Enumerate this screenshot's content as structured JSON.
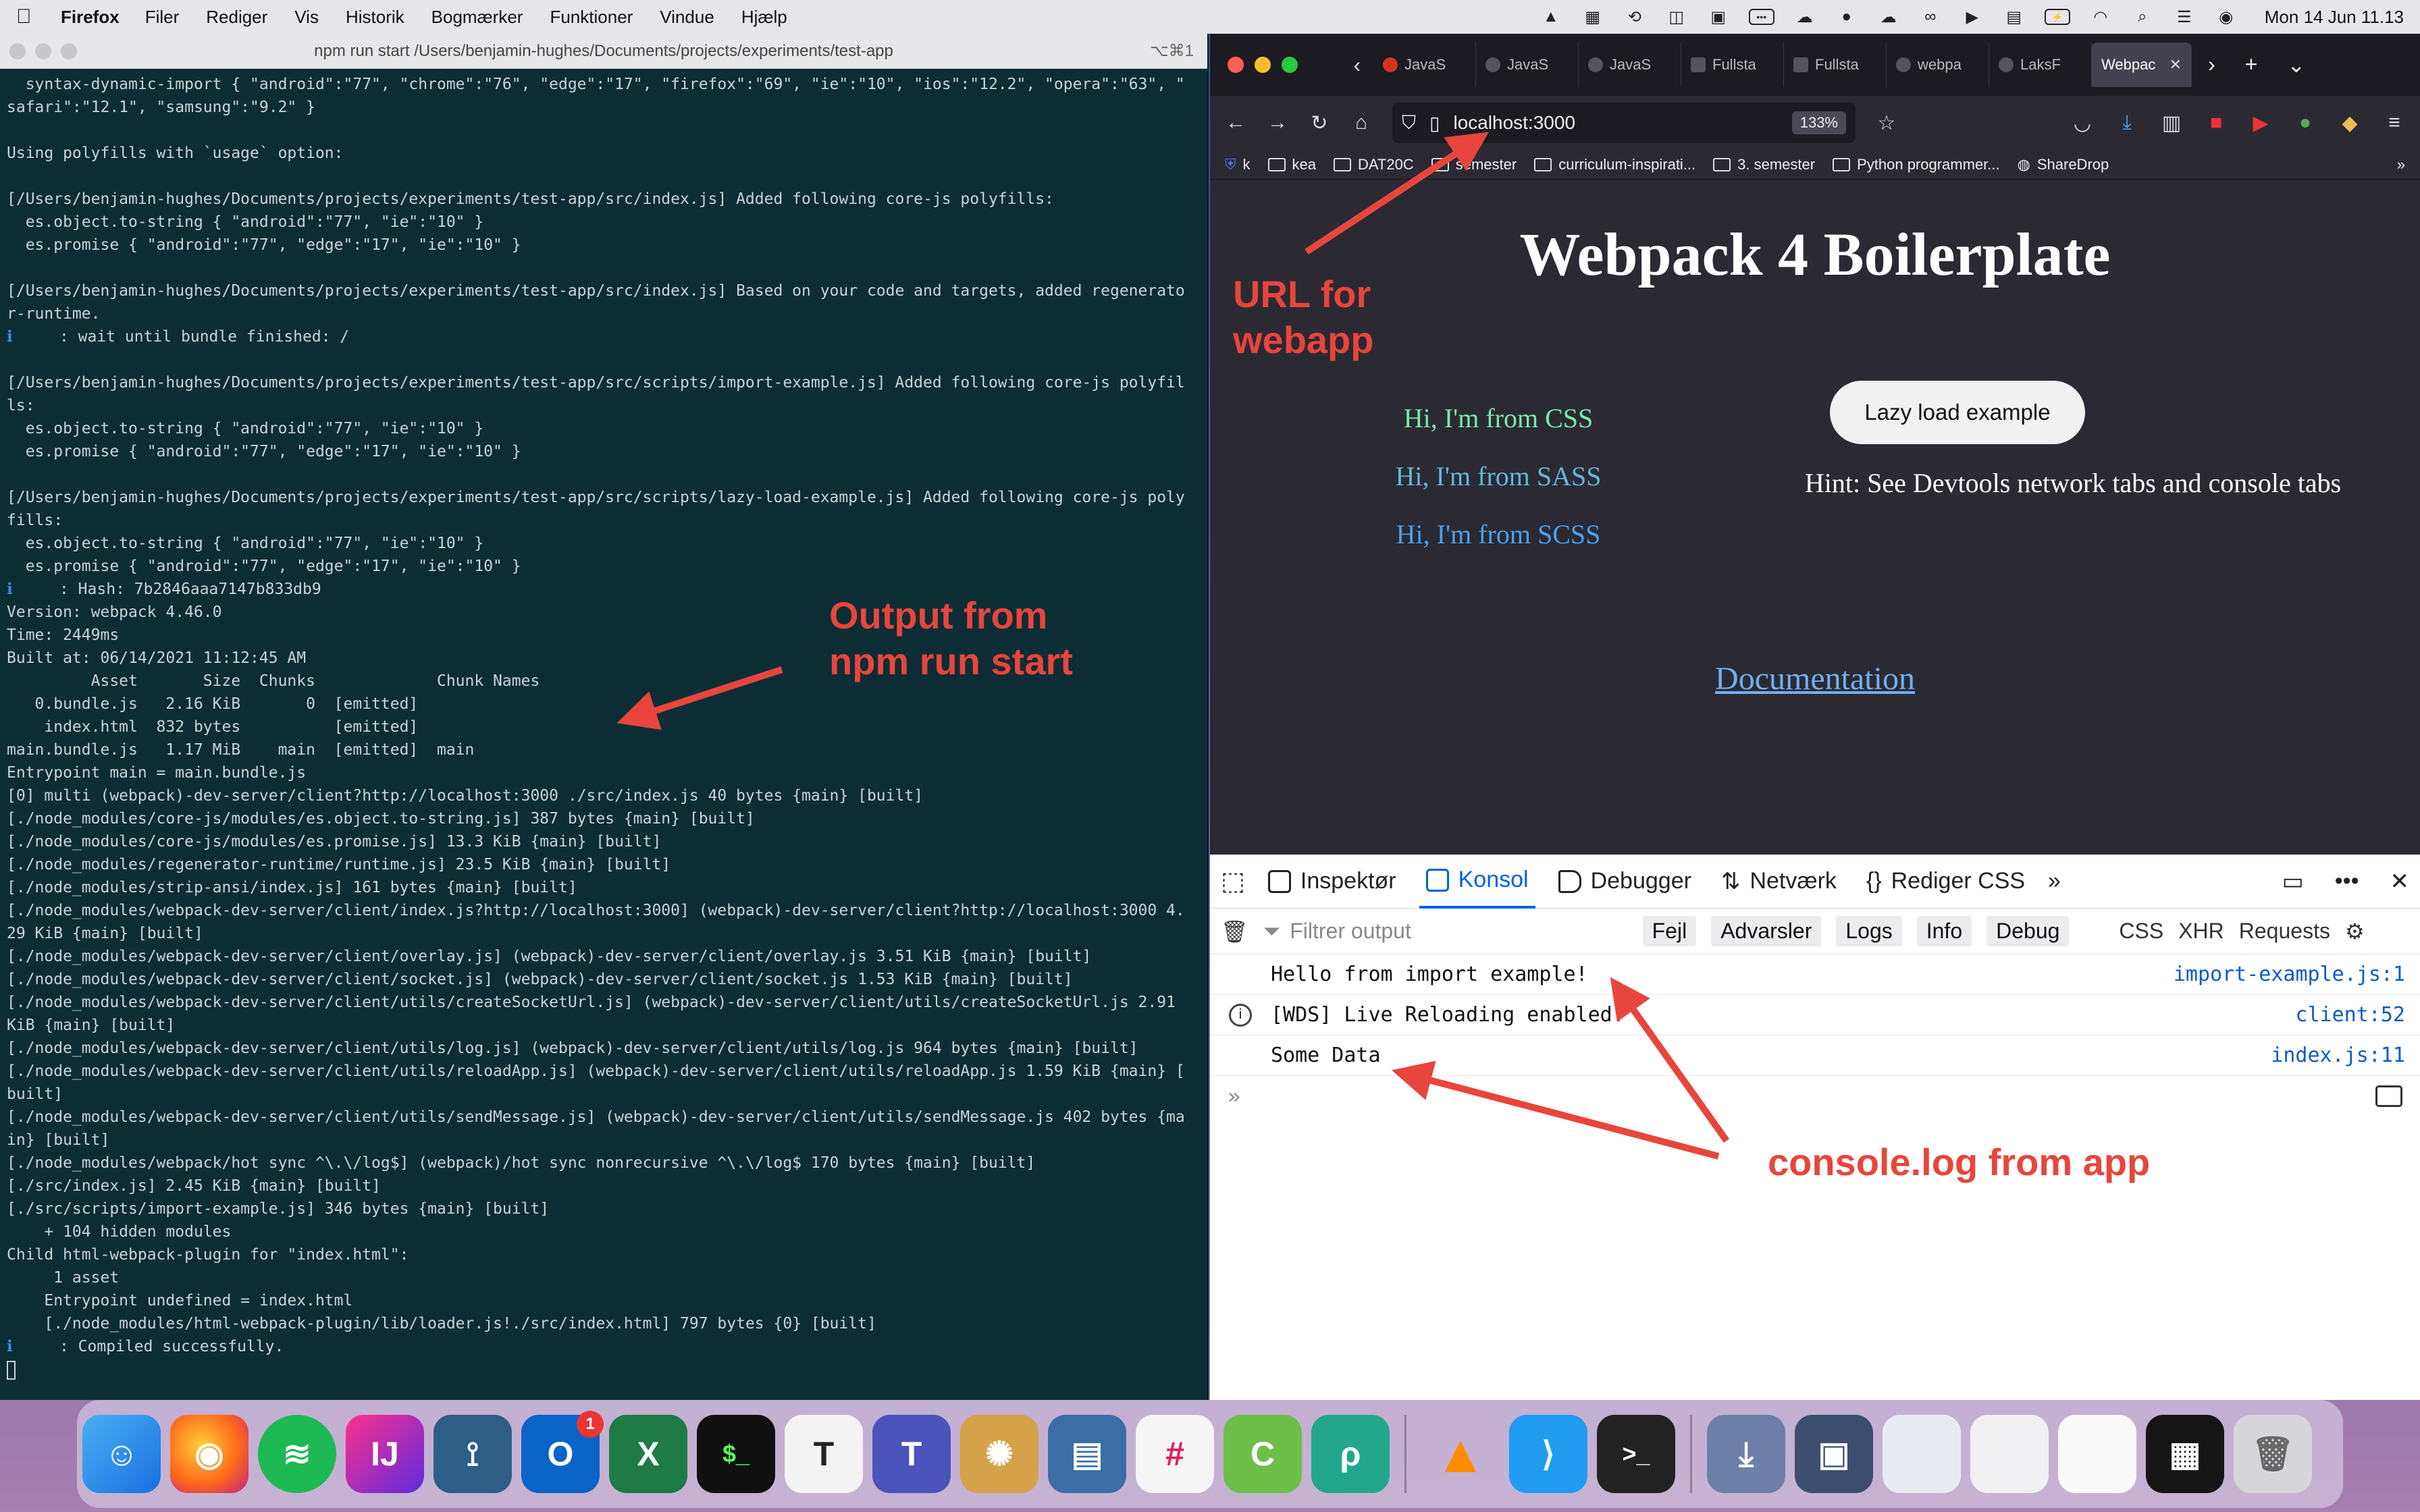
{
  "menubar": {
    "app_name": "Firefox",
    "items": [
      "Filer",
      "Rediger",
      "Vis",
      "Historik",
      "Bogmærker",
      "Funktioner",
      "Vindue",
      "Hjælp"
    ],
    "clock": "Mon 14 Jun  11.13"
  },
  "terminal": {
    "title": "npm run start /Users/benjamin-hughes/Documents/projects/experiments/test-app",
    "shortcut": "⌥⌘1",
    "lines": [
      "  syntax-dynamic-import { \"android\":\"77\", \"chrome\":\"76\", \"edge\":\"17\", \"firefox\":\"69\", \"ie\":\"10\", \"ios\":\"12.2\", \"opera\":\"63\", \"",
      "safari\":\"12.1\", \"samsung\":\"9.2\" }",
      "",
      "Using polyfills with `usage` option:",
      "",
      "[/Users/benjamin-hughes/Documents/projects/experiments/test-app/src/index.js] Added following core-js polyfills:",
      "  es.object.to-string { \"android\":\"77\", \"ie\":\"10\" }",
      "  es.promise { \"android\":\"77\", \"edge\":\"17\", \"ie\":\"10\" }",
      "",
      "[/Users/benjamin-hughes/Documents/projects/experiments/test-app/src/index.js] Based on your code and targets, added regenerato",
      "r-runtime.",
      "ℹ     : wait until bundle finished: /",
      "",
      "[/Users/benjamin-hughes/Documents/projects/experiments/test-app/src/scripts/import-example.js] Added following core-js polyfil",
      "ls:",
      "  es.object.to-string { \"android\":\"77\", \"ie\":\"10\" }",
      "  es.promise { \"android\":\"77\", \"edge\":\"17\", \"ie\":\"10\" }",
      "",
      "[/Users/benjamin-hughes/Documents/projects/experiments/test-app/src/scripts/lazy-load-example.js] Added following core-js poly",
      "fills:",
      "  es.object.to-string { \"android\":\"77\", \"ie\":\"10\" }",
      "  es.promise { \"android\":\"77\", \"edge\":\"17\", \"ie\":\"10\" }",
      "ℹ     : Hash: 7b2846aaa7147b833db9",
      "Version: webpack 4.46.0",
      "Time: 2449ms",
      "Built at: 06/14/2021 11:12:45 AM",
      "         Asset       Size  Chunks             Chunk Names",
      "   0.bundle.js   2.16 KiB       0  [emitted]",
      "    index.html  832 bytes          [emitted]",
      "main.bundle.js   1.17 MiB    main  [emitted]  main",
      "Entrypoint main = main.bundle.js",
      "[0] multi (webpack)-dev-server/client?http://localhost:3000 ./src/index.js 40 bytes {main} [built]",
      "[./node_modules/core-js/modules/es.object.to-string.js] 387 bytes {main} [built]",
      "[./node_modules/core-js/modules/es.promise.js] 13.3 KiB {main} [built]",
      "[./node_modules/regenerator-runtime/runtime.js] 23.5 KiB {main} [built]",
      "[./node_modules/strip-ansi/index.js] 161 bytes {main} [built]",
      "[./node_modules/webpack-dev-server/client/index.js?http://localhost:3000] (webpack)-dev-server/client?http://localhost:3000 4.",
      "29 KiB {main} [built]",
      "[./node_modules/webpack-dev-server/client/overlay.js] (webpack)-dev-server/client/overlay.js 3.51 KiB {main} [built]",
      "[./node_modules/webpack-dev-server/client/socket.js] (webpack)-dev-server/client/socket.js 1.53 KiB {main} [built]",
      "[./node_modules/webpack-dev-server/client/utils/createSocketUrl.js] (webpack)-dev-server/client/utils/createSocketUrl.js 2.91",
      "KiB {main} [built]",
      "[./node_modules/webpack-dev-server/client/utils/log.js] (webpack)-dev-server/client/utils/log.js 964 bytes {main} [built]",
      "[./node_modules/webpack-dev-server/client/utils/reloadApp.js] (webpack)-dev-server/client/utils/reloadApp.js 1.59 KiB {main} [",
      "built]",
      "[./node_modules/webpack-dev-server/client/utils/sendMessage.js] (webpack)-dev-server/client/utils/sendMessage.js 402 bytes {ma",
      "in} [built]",
      "[./node_modules/webpack/hot sync ^\\.\\/log$] (webpack)/hot sync nonrecursive ^\\.\\/log$ 170 bytes {main} [built]",
      "[./src/index.js] 2.45 KiB {main} [built]",
      "[./src/scripts/import-example.js] 346 bytes {main} [built]",
      "    + 104 hidden modules",
      "Child html-webpack-plugin for \"index.html\":",
      "     1 asset",
      "    Entrypoint undefined = index.html",
      "    [./node_modules/html-webpack-plugin/lib/loader.js!./src/index.html] 797 bytes {0} [built]",
      "ℹ     : Compiled successfully."
    ]
  },
  "firefox": {
    "tabs": [
      "JavaS",
      "JavaS",
      "JavaS",
      "Fullsta",
      "Fullsta",
      "webpa",
      "LaksF"
    ],
    "active_tab": "Webpac",
    "url": "localhost:3000",
    "zoom": "133%",
    "bookmarks": [
      "k",
      "kea",
      "DAT20C",
      "semester",
      "curriculum-inspirati...",
      "3. semester",
      "Python programmer...",
      "ShareDrop"
    ],
    "page": {
      "title": "Webpack 4 Boilerplate",
      "css_line": "Hi, I'm from CSS",
      "sass_line": "Hi, I'm from SASS",
      "scss_line": "Hi, I'm from SCSS",
      "lazy_button": "Lazy load example",
      "hint": "Hint: See Devtools network tabs and console tabs",
      "docs_link": "Documentation"
    },
    "devtools": {
      "tabs": [
        "Inspektør",
        "Konsol",
        "Debugger",
        "Netværk",
        "Rediger CSS"
      ],
      "active_tab": "Konsol",
      "filter_placeholder": "Filtrer output",
      "levels": [
        "Fejl",
        "Advarsler",
        "Logs",
        "Info",
        "Debug"
      ],
      "extra": [
        "CSS",
        "XHR",
        "Requests"
      ],
      "console": [
        {
          "msg": "Hello from import example!",
          "src": "import-example.js:1"
        },
        {
          "msg": "[WDS] Live Reloading enabled.",
          "src": "client:52"
        },
        {
          "msg": "Some Data",
          "src": "index.js:11"
        }
      ]
    }
  },
  "annotations": {
    "url": "URL for\nwebapp",
    "npm": "Output from\nnpm run start",
    "console": "console.log from app",
    "color": "#e8453c"
  },
  "colors": {
    "css": "#7ee8a8",
    "sass": "#62b8d6",
    "scss": "#4aa0ee"
  }
}
